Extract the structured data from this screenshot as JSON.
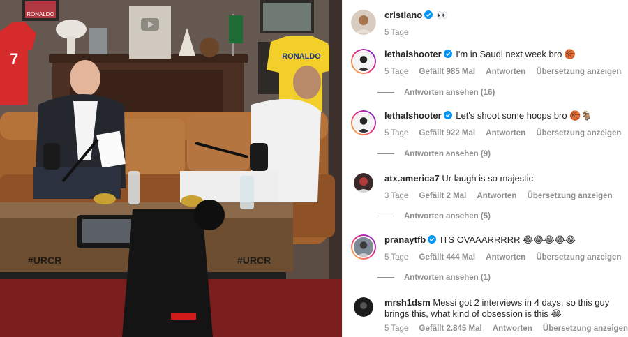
{
  "comments": [
    {
      "username": "cristiano",
      "verified": true,
      "text": "👀",
      "time": "5 Tage",
      "likes": "",
      "reply": "",
      "translate": "",
      "replies": "",
      "avatar": "avatar-cristiano",
      "ring": false
    },
    {
      "username": "lethalshooter",
      "verified": true,
      "text": "I'm in Saudi next week bro 🏀",
      "time": "5 Tage",
      "likes": "Gefällt 985 Mal",
      "reply": "Antworten",
      "translate": "Übersetzung anzeigen",
      "replies": "Antworten ansehen (16)",
      "avatar": "avatar-lethalshooter",
      "ring": true
    },
    {
      "username": "lethalshooter",
      "verified": true,
      "text": "Let's shoot some hoops bro 🏀🐐",
      "time": "5 Tage",
      "likes": "Gefällt 922 Mal",
      "reply": "Antworten",
      "translate": "Übersetzung anzeigen",
      "replies": "Antworten ansehen (9)",
      "avatar": "avatar-lethalshooter",
      "ring": true
    },
    {
      "username": "atx.america7",
      "verified": false,
      "text": "Ur laugh is so majestic",
      "time": "3 Tage",
      "likes": "Gefällt 2 Mal",
      "reply": "Antworten",
      "translate": "Übersetzung anzeigen",
      "replies": "Antworten ansehen (5)",
      "avatar": "avatar-atx",
      "ring": false
    },
    {
      "username": "pranaytfb",
      "verified": true,
      "text": "ITS OVAAARRRRR 😂😂😂😂😂",
      "time": "5 Tage",
      "likes": "Gefällt 444 Mal",
      "reply": "Antworten",
      "translate": "Übersetzung anzeigen",
      "replies": "Antworten ansehen (1)",
      "avatar": "avatar-pranay",
      "ring": true
    },
    {
      "username": "mrsh1dsm",
      "verified": false,
      "text": "Messi got 2 interviews in 4 days, so this guy brings this, what kind of obsession is this 😂",
      "time": "5 Tage",
      "likes": "Gefällt 2.845 Mal",
      "reply": "Antworten",
      "translate": "Übersetzung anzeigen",
      "replies": "",
      "avatar": "avatar-mrsh",
      "ring": false
    }
  ],
  "photo": {
    "jersey_name": "RONALDO",
    "jersey_number": "7",
    "table_logo_left": "#URCR",
    "table_logo_right": "#URCR",
    "frame_label": "RONALDO"
  },
  "colors": {
    "verified": "#0095f6",
    "meta": "#8e8e8e",
    "text": "#262626"
  }
}
